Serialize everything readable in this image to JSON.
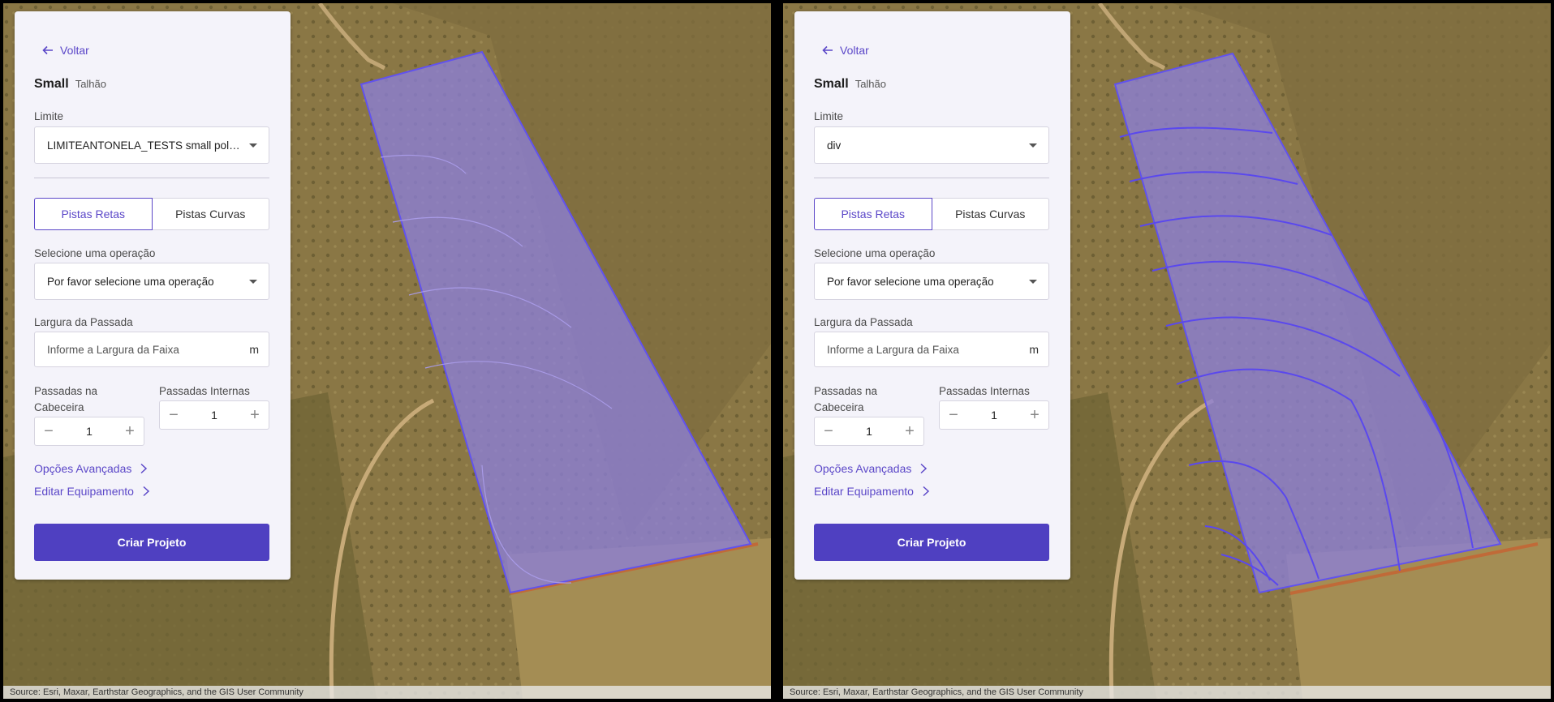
{
  "attribution": "Source: Esri, Maxar, Earthstar Geographics, and the GIS User Community",
  "colors": {
    "accent": "#5b47c8",
    "primary_button": "#4f40c1",
    "field_fill": "#8c7fd8",
    "field_outline": "#6152ee",
    "boundary_road": "#c06a38"
  },
  "panes": [
    {
      "back_label": "Voltar",
      "title": "Small",
      "subtitle": "Talhão",
      "limit_label": "Limite",
      "limit_value": "LIMITEANTONELA_TESTS small poly_boundary",
      "tab_straight": "Pistas Retas",
      "tab_curved": "Pistas Curvas",
      "operation_label": "Selecione uma operação",
      "operation_placeholder": "Por favor selecione uma operação",
      "width_label": "Largura da Passada",
      "width_placeholder": "Informe a Largura da Faixa",
      "width_unit": "m",
      "headland_label": "Passadas na Cabeceira",
      "headland_value": "1",
      "internal_label": "Passadas Internas",
      "internal_value": "1",
      "advanced_link": "Opções Avançadas",
      "equipment_link": "Editar Equipamento",
      "create_button": "Criar Projeto"
    },
    {
      "back_label": "Voltar",
      "title": "Small",
      "subtitle": "Talhão",
      "limit_label": "Limite",
      "limit_value": "div",
      "tab_straight": "Pistas Retas",
      "tab_curved": "Pistas Curvas",
      "operation_label": "Selecione uma operação",
      "operation_placeholder": "Por favor selecione uma operação",
      "width_label": "Largura da Passada",
      "width_placeholder": "Informe a Largura da Faixa",
      "width_unit": "m",
      "headland_label": "Passadas na Cabeceira",
      "headland_value": "1",
      "internal_label": "Passadas Internas",
      "internal_value": "1",
      "advanced_link": "Opções Avançadas",
      "equipment_link": "Editar Equipamento",
      "create_button": "Criar Projeto"
    }
  ]
}
